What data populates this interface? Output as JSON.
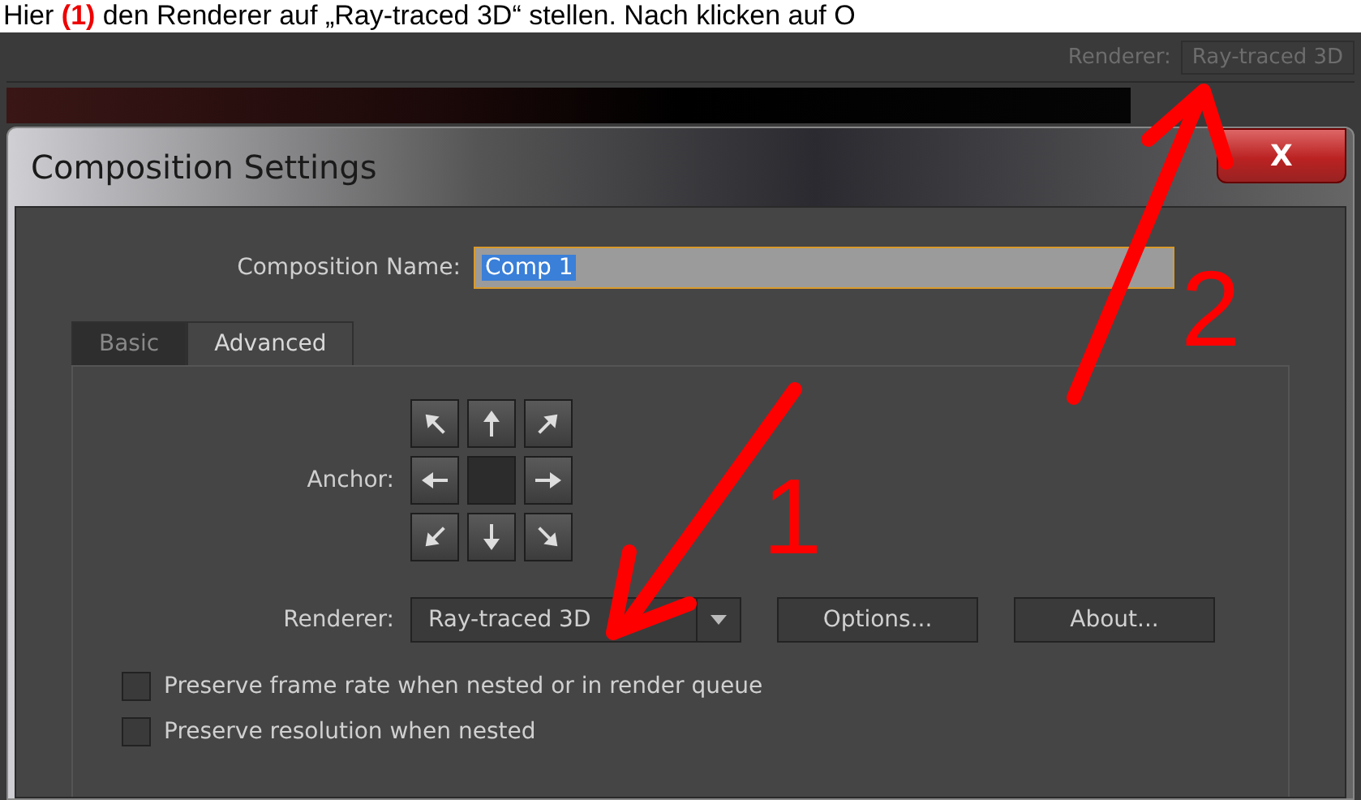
{
  "caption": {
    "before": "Hier ",
    "highlight": "(1)",
    "after": " den Renderer auf „Ray-traced 3D“ stellen. Nach klicken auf O"
  },
  "app_bar": {
    "label": "Renderer:",
    "value": "Ray-traced 3D"
  },
  "dialog": {
    "title": "Composition Settings",
    "close": "X",
    "name_label": "Composition Name:",
    "name_value": "Comp 1",
    "tabs": [
      {
        "label": "Basic",
        "selected": false
      },
      {
        "label": "Advanced",
        "selected": true
      }
    ],
    "anchor_label": "Anchor:",
    "anchor": [
      {
        "kind": "nw",
        "selected": false
      },
      {
        "kind": "n",
        "selected": false
      },
      {
        "kind": "ne",
        "selected": false
      },
      {
        "kind": "w",
        "selected": false
      },
      {
        "kind": "c",
        "selected": true
      },
      {
        "kind": "e",
        "selected": false
      },
      {
        "kind": "sw",
        "selected": false
      },
      {
        "kind": "s",
        "selected": false
      },
      {
        "kind": "se",
        "selected": false
      }
    ],
    "renderer_label": "Renderer:",
    "renderer_value": "Ray-traced 3D",
    "buttons": [
      "Options...",
      "About..."
    ],
    "options": [
      {
        "label": "Preserve frame rate when nested or in render queue",
        "checked": false
      },
      {
        "label": "Preserve resolution when nested",
        "checked": false
      }
    ]
  },
  "annotations": [
    {
      "number": "1"
    },
    {
      "number": "2"
    }
  ]
}
